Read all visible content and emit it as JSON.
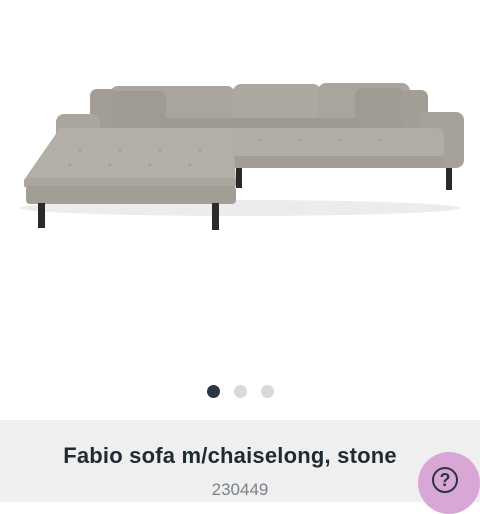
{
  "product": {
    "title": "Fabio sofa m/chaiselong, stone",
    "sku": "230449"
  },
  "gallery": {
    "slide_count": 3,
    "active_slide": 1,
    "image_subject": "sofa-with-chaiselong"
  },
  "help": {
    "icon": "question-mark-icon",
    "glyph": "?"
  },
  "colors": {
    "sofa": "#a8a49c",
    "info_bar": "#efefef",
    "help_button": "#d9a7d6",
    "active_dot": "#2b3640"
  }
}
